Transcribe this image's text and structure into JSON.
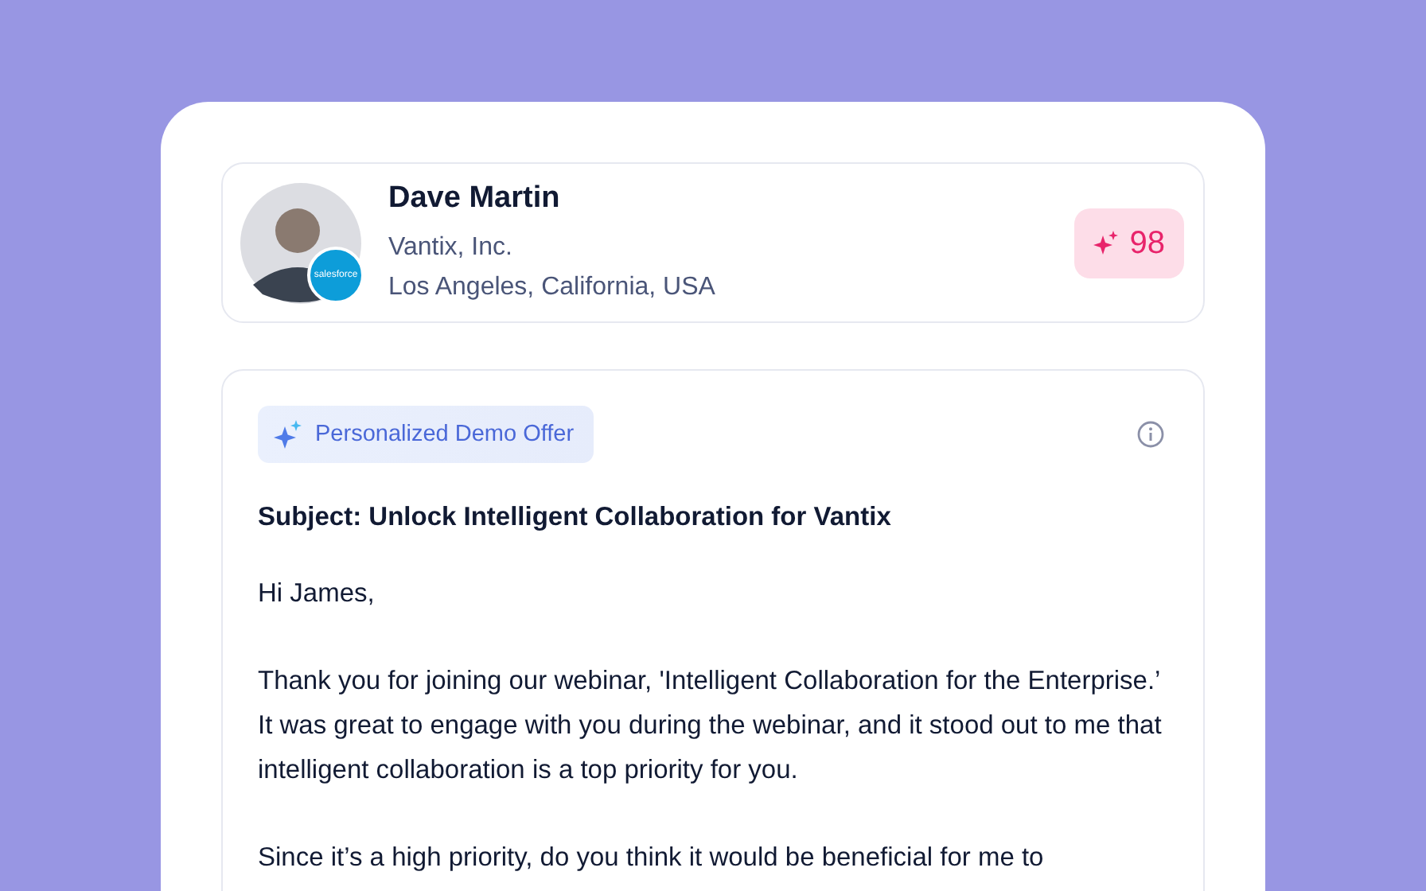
{
  "contact": {
    "name": "Dave Martin",
    "company": "Vantix, Inc.",
    "location": "Los Angeles, California, USA",
    "crm_badge": "salesforce",
    "score": "98"
  },
  "email": {
    "tag": "Personalized Demo Offer",
    "subject": "Subject: Unlock Intelligent Collaboration for Vantix",
    "paragraphs": [
      "Hi James,",
      "Thank you for joining our webinar, 'Intelligent Collaboration for the Enterprise.’ It was great to engage with you during the webinar, and it stood out to me that intelligent collaboration is a top priority for you.",
      "Since it’s a high priority, do you think it would be beneficial for me to"
    ]
  }
}
